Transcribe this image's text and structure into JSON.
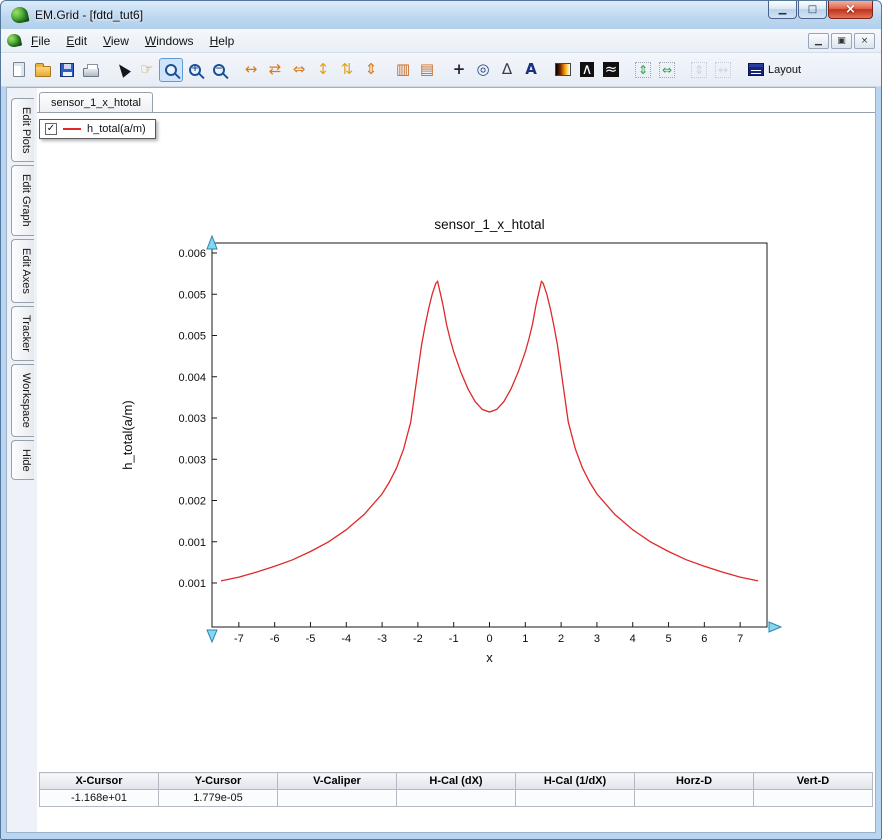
{
  "window": {
    "title": "EM.Grid - [fdtd_tut6]",
    "controls": [
      {
        "name": "minimize-button",
        "glyph": "▁"
      },
      {
        "name": "maximize-button",
        "glyph": "□"
      },
      {
        "name": "close-button",
        "glyph": "×"
      }
    ]
  },
  "menubar": {
    "menus": [
      {
        "label": "File"
      },
      {
        "label": "Edit"
      },
      {
        "label": "View"
      },
      {
        "label": "Windows"
      },
      {
        "label": "Help"
      }
    ],
    "mdi_controls": [
      {
        "name": "mdi-minimize-button",
        "glyph": "▁"
      },
      {
        "name": "mdi-restore-button",
        "glyph": "▣"
      },
      {
        "name": "mdi-close-button",
        "glyph": "×"
      }
    ]
  },
  "toolbar": {
    "items": [
      {
        "name": "new-file-button",
        "shape": "page"
      },
      {
        "name": "open-file-button",
        "shape": "folder"
      },
      {
        "name": "save-button",
        "shape": "floppy"
      },
      {
        "name": "print-button",
        "shape": "printer",
        "sep_after": true
      },
      {
        "name": "select-cursor-button",
        "shape": "cursor"
      },
      {
        "name": "pan-hand-button",
        "glyph": "☞",
        "color": "#c8922a"
      },
      {
        "name": "zoom-window-button",
        "shape": "mag",
        "state": "active"
      },
      {
        "name": "zoom-in-button",
        "shape": "mag",
        "mag_sign": "+"
      },
      {
        "name": "zoom-out-button",
        "shape": "mag",
        "mag_sign": "−",
        "sep_after": true
      },
      {
        "name": "expand-x-button",
        "glyph": "↔",
        "color": "#e07818"
      },
      {
        "name": "compress-x-button",
        "glyph": "⇄",
        "color": "#e07818"
      },
      {
        "name": "fit-x-button",
        "glyph": "⇔",
        "color": "#e07818"
      },
      {
        "name": "expand-y-button",
        "glyph": "↕",
        "color": "#e8a018"
      },
      {
        "name": "compress-y-button",
        "glyph": "⇅",
        "color": "#e8a018"
      },
      {
        "name": "fit-y-button",
        "glyph": "⇕",
        "color": "#e07818",
        "sep_after": true
      },
      {
        "name": "vertical-markers-button",
        "glyph": "▥",
        "color": "#c86820"
      },
      {
        "name": "horizontal-markers-button",
        "glyph": "▤",
        "color": "#c86820",
        "sep_after": true
      },
      {
        "name": "crosshair-button",
        "glyph": "+",
        "color": "#26282e",
        "bold": true
      },
      {
        "name": "tracker-button",
        "glyph": "◎",
        "color": "#284888"
      },
      {
        "name": "caliper-button",
        "glyph": "∆",
        "color": "#3c3e46"
      },
      {
        "name": "text-annotation-button",
        "glyph": "A",
        "color": "#18307c",
        "bold": true,
        "sep_after": true
      },
      {
        "name": "colormap-button",
        "shape": "grad"
      },
      {
        "name": "fft-plot-button",
        "glyph": "∧",
        "color": "#ffffff",
        "bg": "#101010"
      },
      {
        "name": "waveform-plot-button",
        "glyph": "≈",
        "color": "#ffffff",
        "bg": "#101010",
        "sep_after": true
      },
      {
        "name": "span-vertical-button",
        "glyph": "⇕",
        "color": "#2a9a4a",
        "boxed": true
      },
      {
        "name": "span-horizontal-button",
        "glyph": "⇔",
        "color": "#2a9a4a",
        "boxed": true,
        "sep_after": true
      },
      {
        "name": "span-vertical-disabled-button",
        "glyph": "⇕",
        "color": "#b0b6c0",
        "boxed": true,
        "state": "disabled"
      },
      {
        "name": "span-horizontal-disabled-button",
        "glyph": "↔",
        "color": "#b0b6c0",
        "boxed": true,
        "state": "disabled",
        "sep_after": true
      },
      {
        "name": "layout-button",
        "shape": "layout",
        "label": "Layout"
      }
    ]
  },
  "sidebar": {
    "tabs": [
      {
        "label": "Edit Plots"
      },
      {
        "label": "Edit Graph"
      },
      {
        "label": "Edit Axes"
      },
      {
        "label": "Tracker"
      },
      {
        "label": "Workspace"
      },
      {
        "label": "Hide"
      }
    ]
  },
  "document": {
    "tab": "sensor_1_x_htotal"
  },
  "legend": {
    "label": "h_total(a/m)",
    "checked": true,
    "line_color": "#e02828"
  },
  "chart_data": {
    "type": "line",
    "title": "sensor_1_x_htotal",
    "xlabel": "x",
    "ylabel": "h_total(a/m)",
    "xlim": [
      -7.75,
      7.75
    ],
    "ylim": [
      0,
      0.006
    ],
    "grid": false,
    "legend": [
      "h_total(a/m)"
    ],
    "legend_position": "floating-top-left",
    "xticks": [
      -7,
      -6,
      -5,
      -4,
      -3,
      -2,
      -1,
      0,
      1,
      2,
      3,
      4,
      5,
      6,
      7
    ],
    "ytick_labels": [
      "0.006",
      "0.005",
      "0.005",
      "0.004",
      "0.003",
      "0.003",
      "0.002",
      "0.001",
      "0.001"
    ],
    "series": [
      {
        "name": "h_total(a/m)",
        "color": "#e02828",
        "x": [
          -7.5,
          -7,
          -6.5,
          -6,
          -5.5,
          -5,
          -4.5,
          -4,
          -3.5,
          -3,
          -2.8,
          -2.6,
          -2.4,
          -2.2,
          -2.1,
          -2,
          -1.9,
          -1.8,
          -1.7,
          -1.6,
          -1.5,
          -1.45,
          -1.4,
          -1.3,
          -1.2,
          -1.1,
          -1,
          -0.8,
          -0.6,
          -0.4,
          -0.2,
          0,
          0.2,
          0.4,
          0.6,
          0.8,
          1,
          1.1,
          1.2,
          1.3,
          1.4,
          1.45,
          1.5,
          1.6,
          1.7,
          1.8,
          1.9,
          2,
          2.1,
          2.2,
          2.4,
          2.6,
          2.8,
          3,
          3.5,
          4,
          4.5,
          5,
          5.5,
          6,
          6.5,
          7,
          7.5
        ],
        "y": [
          0.00072,
          0.00078,
          0.00086,
          0.00095,
          0.00105,
          0.00118,
          0.00133,
          0.00152,
          0.00176,
          0.00208,
          0.00226,
          0.00248,
          0.00278,
          0.0032,
          0.0036,
          0.004,
          0.0044,
          0.0047,
          0.00497,
          0.0052,
          0.00537,
          0.0054,
          0.00528,
          0.00503,
          0.00473,
          0.0045,
          0.0043,
          0.00398,
          0.00372,
          0.00352,
          0.0034,
          0.00336,
          0.0034,
          0.00352,
          0.00372,
          0.00398,
          0.0043,
          0.0045,
          0.00473,
          0.00503,
          0.00528,
          0.0054,
          0.00537,
          0.0052,
          0.00497,
          0.0047,
          0.0044,
          0.004,
          0.0036,
          0.0032,
          0.00278,
          0.00248,
          0.00226,
          0.00208,
          0.00176,
          0.00152,
          0.00133,
          0.00118,
          0.00105,
          0.00095,
          0.00086,
          0.00078,
          0.00072
        ]
      }
    ]
  },
  "status_table": {
    "headers": [
      "X-Cursor",
      "Y-Cursor",
      "V-Caliper",
      "H-Cal (dX)",
      "H-Cal (1/dX)",
      "Horz-D",
      "Vert-D"
    ],
    "values": [
      "-1.168e+01",
      "1.779e-05",
      "",
      "",
      "",
      "",
      ""
    ]
  }
}
